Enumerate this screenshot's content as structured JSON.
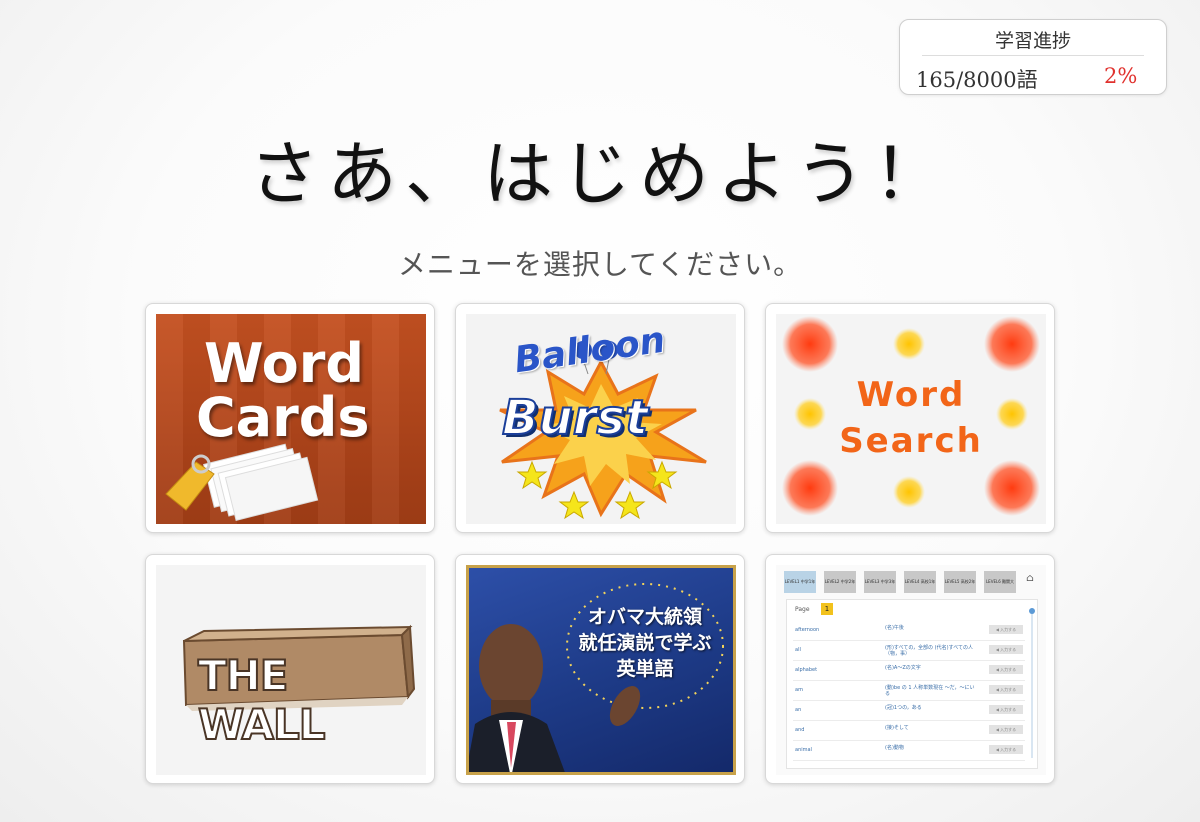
{
  "progress": {
    "title": "学習進捗",
    "count": "165/8000語",
    "percent": "2%"
  },
  "headline": "さあ、はじめよう！",
  "subtitle": "メニューを選択してください。",
  "menu": [
    {
      "line1": "Word",
      "line2": "Cards"
    },
    {
      "line1": "Balloon",
      "line2": "Burst"
    },
    {
      "line1": "Word",
      "line2": "Search"
    },
    {
      "line1": "THE WALL"
    },
    {
      "line1": "オバマ大統領",
      "line2": "就任演説で学ぶ",
      "line3": "英単語"
    },
    {
      "tabs": [
        "LEVEL1\n中学1年生",
        "LEVEL2\n中学2年生",
        "LEVEL3\n中学3年生",
        "LEVEL4\n高校1年生\n高校初級",
        "LEVEL5\n高校2年生\n大学初",
        "LEVEL6\n難関大学"
      ],
      "page_label": "Page",
      "page_number": "1",
      "rows": [
        {
          "word": "afternoon",
          "meaning": "(名)午後"
        },
        {
          "word": "all",
          "meaning": "(形)すべての，全部の (代名)すべての人（物，事）"
        },
        {
          "word": "alphabet",
          "meaning": "(名)A～Zの文字"
        },
        {
          "word": "am",
          "meaning": "(動)be の 1 人称単数現在 ～だ，～にいる"
        },
        {
          "word": "an",
          "meaning": "(冠)1つの，ある"
        },
        {
          "word": "and",
          "meaning": "(接)そして"
        },
        {
          "word": "animal",
          "meaning": "(名)動物"
        }
      ],
      "button_label": "◀ 入力する"
    }
  ],
  "colors": {
    "accent_red": "#e0312d",
    "word_cards_bg": "#b4461a",
    "word_search_orange": "#f26518",
    "obama_blue": "#1d3a86"
  }
}
